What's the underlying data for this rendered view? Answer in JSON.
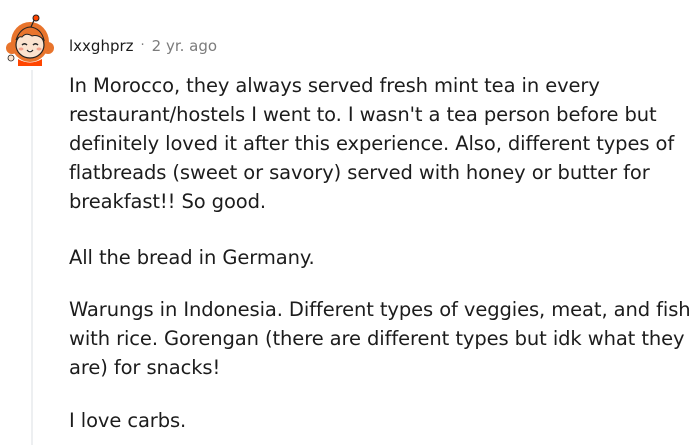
{
  "comment": {
    "username": "lxxghprz",
    "separator": "·",
    "age": "2 yr. ago",
    "paragraphs": [
      "In Morocco, they always served fresh mint tea in every restaurant/hostels I went to. I wasn't a tea person before but definitely loved it after this experience. Also, different types of flatbreads (sweet or savory) served with honey or butter for breakfast!! So good.",
      "All the bread in Germany.",
      "Warungs in Indonesia. Different types of veggies, meat, and fish with rice. Gorengan (there are different types but idk what they are) for snacks!",
      "I love carbs."
    ]
  },
  "avatar": {
    "icon": "snoo-avatar-icon",
    "hair_color": "#e8742c",
    "skin_color": "#fbe3cf",
    "accent_color": "#ff4500"
  },
  "colors": {
    "text": "#1c1c1c",
    "meta_text": "#7c7c7c",
    "thread_line": "#edeff1"
  }
}
